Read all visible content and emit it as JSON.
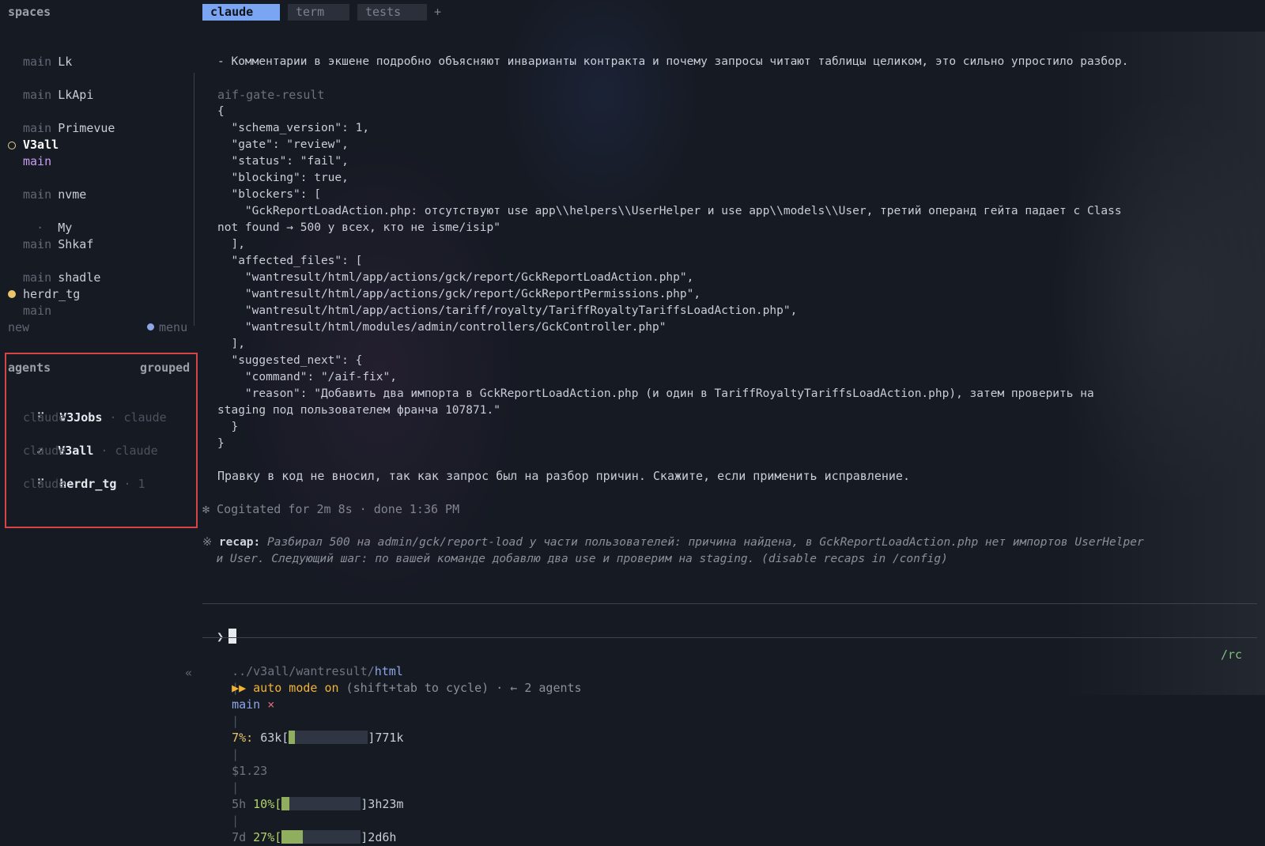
{
  "sidebar": {
    "title": "spaces",
    "items": [
      {
        "name": "Lk",
        "branch": "main",
        "marker": "dot"
      },
      {
        "name": "LkApi",
        "branch": "main",
        "marker": "dot"
      },
      {
        "name": "Primevue",
        "branch": "main",
        "marker": "dot"
      },
      {
        "name": "V3all",
        "branch": "main",
        "marker": "ring",
        "active": true
      },
      {
        "name": "nvme",
        "branch": "main",
        "marker": "dot"
      },
      {
        "name": "My",
        "branch": "",
        "marker": "dot"
      },
      {
        "name": "Shkaf",
        "branch": "main",
        "marker": "dot"
      },
      {
        "name": "shadle",
        "branch": "main",
        "marker": "dot"
      },
      {
        "name": "herdr_tg",
        "branch": "main",
        "marker": "filled"
      }
    ],
    "dot_glyph": "·",
    "new_label": "new",
    "menu_label": "menu"
  },
  "agents": {
    "title": "agents",
    "mode": "grouped",
    "items": [
      {
        "icon": "⠋",
        "name": "V3Jobs",
        "meta": "· claude",
        "sub": "claude"
      },
      {
        "icon": "✓",
        "name": "V3all",
        "meta": "· claude",
        "sub": "claude"
      },
      {
        "icon": "⠋",
        "name": "herdr_tg",
        "meta": "· 1",
        "sub": "claude"
      }
    ]
  },
  "tabs": [
    {
      "label": "claude",
      "active": true
    },
    {
      "label": "term",
      "active": false
    },
    {
      "label": "tests",
      "active": false
    }
  ],
  "tab_add": "+",
  "content": {
    "line1": "- Комментарии в экшене подробно объясняют инварианты контракта и почему запросы читают таблицы целиком, это сильно упростило разбор.",
    "label": "aif-gate-result",
    "json_lines": [
      "{",
      "  \"schema_version\": 1,",
      "  \"gate\": \"review\",",
      "  \"status\": \"fail\",",
      "  \"blocking\": true,",
      "  \"blockers\": [",
      "    \"GckReportLoadAction.php: отсутствуют use app\\\\helpers\\\\UserHelper и use app\\\\models\\\\User, третий операнд гейта падает с Class",
      "not found → 500 у всех, кто не isme/isip\"",
      "  ],",
      "  \"affected_files\": [",
      "    \"wantresult/html/app/actions/gck/report/GckReportLoadAction.php\",",
      "    \"wantresult/html/app/actions/gck/report/GckReportPermissions.php\",",
      "    \"wantresult/html/app/actions/tariff/royalty/TariffRoyaltyTariffsLoadAction.php\",",
      "    \"wantresult/html/modules/admin/controllers/GckController.php\"",
      "  ],",
      "  \"suggested_next\": {",
      "    \"command\": \"/aif-fix\",",
      "    \"reason\": \"Добавить два импорта в GckReportLoadAction.php (и один в TariffRoyaltyTariffsLoadAction.php), затем проверить на",
      "staging под пользователем франча 107871.\"",
      "  }",
      "}"
    ],
    "closing": "Правку в код не вносил, так как запрос был на разбор причин. Скажите, если применить исправление.",
    "cogitated": "✻ Cogitated for 2m 8s · done 1:36 PM",
    "recap_mark": "※",
    "recap_label": "recap:",
    "recap_line1": " Разбирал 500 на admin/gck/report-load у части пользователей: причина найдена, в GckReportLoadAction.php нет импортов UserHelper",
    "recap_line2": "  и User. Следующий шаг: по вашей команде добавлю два use и проверим на staging. (disable recaps in /config)"
  },
  "prompt": {
    "caret": "❯"
  },
  "status": {
    "path_prefix": "../v3all/wantresult/",
    "path_tail": "html",
    "sep": "|",
    "branch": "main",
    "branch_dirty": "×",
    "ctx_pct": "7%:",
    "ctx_used": "63k[",
    "ctx_fraction": 0.08,
    "ctx_total": "]771k",
    "cost": "$1.23",
    "win5_label": "5h",
    "win5_pct": "10%[",
    "win5_fraction": 0.1,
    "win5_reset": "]3h23m",
    "win7_label": "7d",
    "win7_pct": "27%[",
    "win7_fraction": 0.27,
    "win7_reset": "]2d6h",
    "rc": "/rc",
    "auto_arrows": "▶▶",
    "auto_text": "auto mode on",
    "auto_sub": " (shift+tab to cycle) · ← 2 agents",
    "left_chevron": "«"
  }
}
